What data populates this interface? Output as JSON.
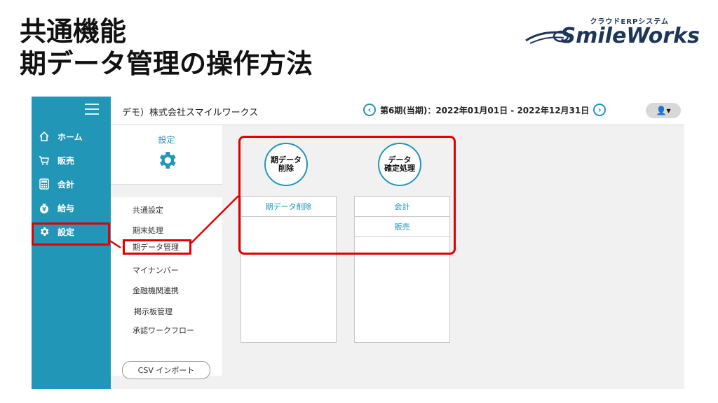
{
  "slide": {
    "title_line1": "共通機能",
    "title_line2": "期データ管理の操作方法"
  },
  "logo": {
    "tagline": "クラウドERPシステム",
    "name": "SmileWorks"
  },
  "header": {
    "company": "デモ）株式会社スマイルワークス",
    "period": "第6期(当期)：2022年01月01日 - 2022年12月31日",
    "prev_icon": "‹",
    "next_icon": "›",
    "user_icon": "👤▾"
  },
  "sidebar": {
    "items": [
      {
        "label": "ホーム",
        "icon": "home-icon"
      },
      {
        "label": "販売",
        "icon": "cart-icon"
      },
      {
        "label": "会計",
        "icon": "calculator-icon"
      },
      {
        "label": "給与",
        "icon": "money-bag-icon"
      },
      {
        "label": "設定",
        "icon": "gear-icon"
      }
    ]
  },
  "submenu": {
    "header_label": "設定",
    "items": [
      "共通設定",
      "期末処理",
      "期データ管理",
      "マイナンバー",
      "金融機関連携",
      "掲示板管理",
      "承認ワークフロー"
    ],
    "csv_button": "CSV インポート"
  },
  "main": {
    "tile1": {
      "line1": "期データ",
      "line2": "削除",
      "rows": [
        "期データ削除"
      ]
    },
    "tile2": {
      "line1": "データ",
      "line2": "確定処理",
      "rows": [
        "会計",
        "販売"
      ]
    }
  },
  "colors": {
    "sidebar": "#2196b6",
    "accent": "#2196b6",
    "highlight": "#e00000"
  }
}
